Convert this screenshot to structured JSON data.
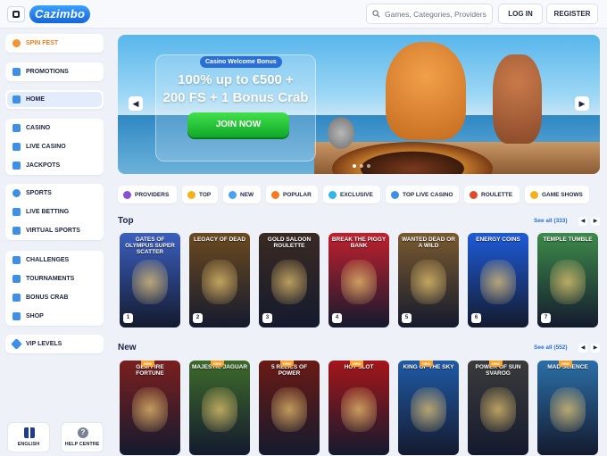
{
  "header": {
    "logo": "Cazimbo",
    "search_placeholder": "Games, Categories, Providers",
    "login_label": "LOG IN",
    "register_label": "REGISTER"
  },
  "sidebar": {
    "groups": [
      [
        {
          "label": "SPIN FEST",
          "icon": "spin-fest-icon"
        }
      ],
      [
        {
          "label": "PROMOTIONS",
          "icon": "gift-icon"
        }
      ],
      [
        {
          "label": "HOME",
          "icon": "home-icon"
        }
      ],
      [
        {
          "label": "CASINO",
          "icon": "slot-icon"
        },
        {
          "label": "LIVE CASINO",
          "icon": "live-casino-icon"
        },
        {
          "label": "JACKPOTS",
          "icon": "jackpot-icon"
        }
      ],
      [
        {
          "label": "SPORTS",
          "icon": "sports-ball-icon"
        },
        {
          "label": "LIVE BETTING",
          "icon": "live-betting-icon"
        },
        {
          "label": "VIRTUAL SPORTS",
          "icon": "gamepad-icon"
        }
      ],
      [
        {
          "label": "CHALLENGES",
          "icon": "challenges-icon"
        },
        {
          "label": "TOURNAMENTS",
          "icon": "trophy-icon"
        },
        {
          "label": "BONUS CRAB",
          "icon": "crab-icon"
        },
        {
          "label": "SHOP",
          "icon": "shop-icon"
        }
      ],
      [
        {
          "label": "VIP LEVELS",
          "icon": "diamond-icon"
        }
      ]
    ],
    "language_label": "ENGLISH",
    "help_label": "HELP CENTRE"
  },
  "hero": {
    "badge": "Casino Welcome Bonus",
    "line1": "100% up to €500 +",
    "line2": "200 FS + 1 Bonus Crab",
    "cta": "JOIN NOW"
  },
  "chips": [
    "PROVIDERS",
    "TOP",
    "NEW",
    "POPULAR",
    "EXCLUSIVE",
    "TOP LIVE CASINO",
    "ROULETTE",
    "GAME SHOWS"
  ],
  "sections": {
    "top": {
      "title": "Top",
      "see_all": "See all (333)"
    },
    "new": {
      "title": "New",
      "see_all": "See all (552)"
    }
  },
  "top_games": [
    {
      "title": "Gates of Olympus Super Scatter",
      "rank": "1",
      "color": "#3b5fc0"
    },
    {
      "title": "Legacy of Dead",
      "rank": "2",
      "color": "#6b4a1f"
    },
    {
      "title": "Gold Saloon Roulette",
      "rank": "3",
      "color": "#3a2a22"
    },
    {
      "title": "Break the Piggy Bank",
      "rank": "4",
      "color": "#c0202e"
    },
    {
      "title": "Wanted Dead or a Wild",
      "rank": "5",
      "color": "#7a5a2e"
    },
    {
      "title": "Energy Coins",
      "rank": "6",
      "color": "#1e5bd8"
    },
    {
      "title": "Temple Tumble",
      "rank": "7",
      "color": "#3d8a4a"
    }
  ],
  "new_games": [
    {
      "title": "Gem Fire Fortune",
      "badge": "new",
      "color": "#7a1f1f"
    },
    {
      "title": "Majestic Jaguar",
      "badge": "new",
      "color": "#3d6a2a"
    },
    {
      "title": "5 Relics of Power",
      "badge": "new",
      "color": "#6a1a14"
    },
    {
      "title": "Hot Slot",
      "badge": "new",
      "color": "#a4161a"
    },
    {
      "title": "King of the Sky",
      "badge": "new",
      "color": "#1f5aa6"
    },
    {
      "title": "Power of Sun Svarog",
      "badge": "new",
      "color": "#3b3b3b"
    },
    {
      "title": "Mad Science",
      "badge": "new",
      "color": "#2b6fa8"
    }
  ],
  "colors": {
    "accent": "#2a6fd6",
    "cta_green": "#12a82a",
    "spin_orange": "#f07a1a"
  }
}
